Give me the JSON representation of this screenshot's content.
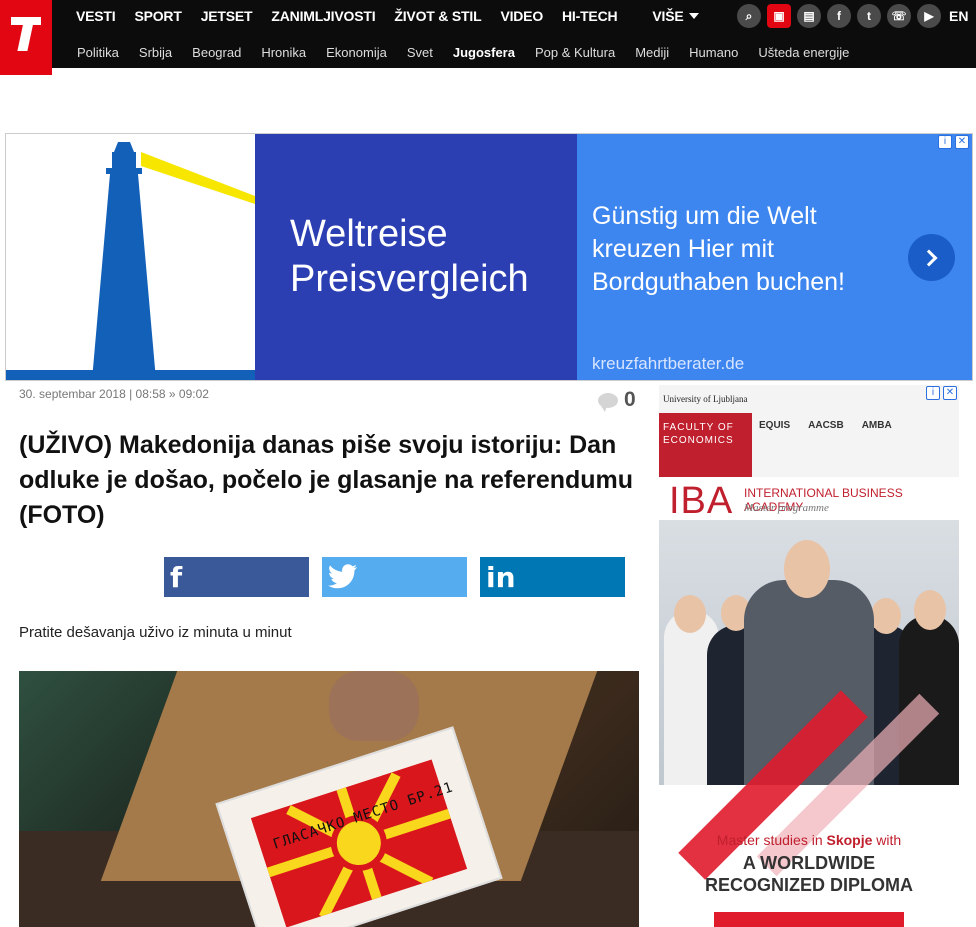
{
  "header": {
    "logo_alt": "Telegraf logo",
    "main_nav": [
      "VESTI",
      "SPORT",
      "JETSET",
      "ZANIMLJIVOSTI",
      "ŽIVOT & STIL",
      "VIDEO",
      "HI-TECH"
    ],
    "more_label": "VIŠE",
    "lang_label": "EN",
    "icons": [
      "search-icon",
      "tv-icon",
      "radio-icon",
      "facebook-icon",
      "twitter-icon",
      "viber-icon",
      "youtube-icon"
    ],
    "sub_nav": [
      "Politika",
      "Srbija",
      "Beograd",
      "Hronika",
      "Ekonomija",
      "Svet",
      "Jugosfera",
      "Pop & Kultura",
      "Mediji",
      "Humano",
      "Ušteda energije"
    ],
    "active_sub": "Jugosfera"
  },
  "banner_ad": {
    "headline": "Weltreise Preisvergleich",
    "text": "Günstig um die Welt kreuzen Hier mit Bordguthaben buchen!",
    "domain": "kreuzfahrtberater.de",
    "info": "i",
    "close": "✕"
  },
  "article": {
    "meta": "30. septembar 2018 | 08:58 » 09:02",
    "comments": "0",
    "title": "(UŽIVO) Makedonija danas piše svoju istoriju: Dan odluke je došao, počelo je glasanje na referendumu (FOTO)",
    "share": {
      "facebook": "f",
      "twitter": "🐦",
      "linkedin": "in"
    },
    "lead": "Pratite dešavanja uživo iz minuta u minut",
    "photo_text": "ГЛАСАЧКО МЕСТО БР.21"
  },
  "side_ad": {
    "university": "University of Ljubljana",
    "faculty": "FACULTY OF ECONOMICS",
    "accreditations": [
      "EQUIS",
      "AACSB",
      "AMBA"
    ],
    "iba": "IBA",
    "iba_name": "INTERNATIONAL BUSINESS ACADEMY",
    "iba_sub": "Master programme",
    "cta_line1_prefix": "Master studies in ",
    "cta_line1_city": "Skopje",
    "cta_line1_suffix": " with",
    "cta_line2": "A WORLDWIDE",
    "cta_line3": "RECOGNIZED DIPLOMA"
  },
  "colors": {
    "brand": "#e20613",
    "header_bg": "#0c0c0c",
    "facebook": "#3a5998",
    "twitter": "#55acee",
    "linkedin": "#0077b5"
  }
}
